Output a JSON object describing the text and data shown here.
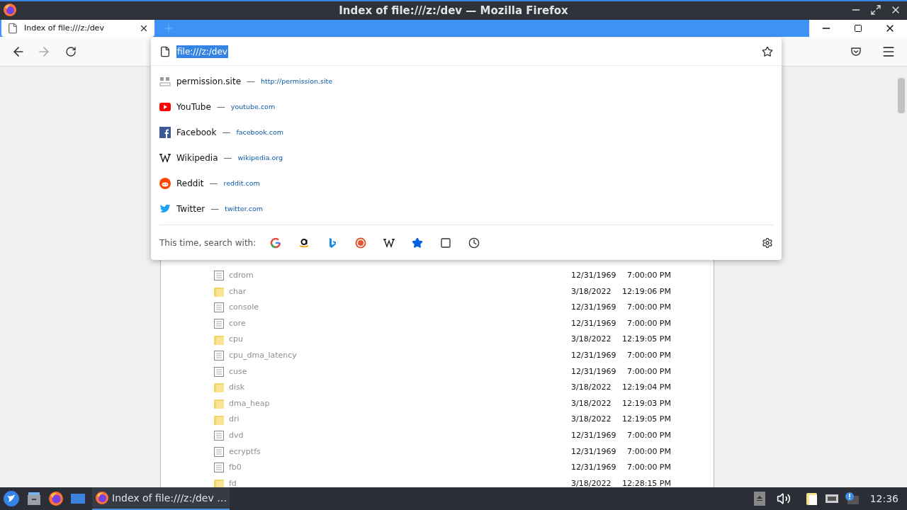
{
  "window": {
    "title": "Index of file:///z:/dev — Mozilla Firefox"
  },
  "tab": {
    "title": "Index of file:///z:/dev",
    "selected": true
  },
  "urlbar": {
    "value": "file:///z:/dev"
  },
  "suggestion_separator": "—",
  "suggestions": [
    {
      "kind": "permission",
      "title": "permission.site",
      "url": "http://permission.site"
    },
    {
      "kind": "youtube",
      "title": "YouTube",
      "url": "youtube.com"
    },
    {
      "kind": "facebook",
      "title": "Facebook",
      "url": "facebook.com"
    },
    {
      "kind": "wikipedia",
      "title": "Wikipedia",
      "url": "wikipedia.org"
    },
    {
      "kind": "reddit",
      "title": "Reddit",
      "url": "reddit.com"
    },
    {
      "kind": "twitter",
      "title": "Twitter",
      "url": "twitter.com"
    }
  ],
  "search_with": {
    "label": "This time, search with:",
    "engines": [
      {
        "kind": "google"
      },
      {
        "kind": "amazon"
      },
      {
        "kind": "bing"
      },
      {
        "kind": "duckduckgo"
      },
      {
        "kind": "wikipedia"
      },
      {
        "kind": "bookmarks"
      },
      {
        "kind": "tabs"
      },
      {
        "kind": "history"
      }
    ]
  },
  "listing": [
    {
      "kind": "file",
      "name": "cdrom",
      "date": "12/31/1969",
      "time": "7:00:00 PM"
    },
    {
      "kind": "folder",
      "name": "char",
      "date": "3/18/2022",
      "time": "12:19:06 PM"
    },
    {
      "kind": "file",
      "name": "console",
      "date": "12/31/1969",
      "time": "7:00:00 PM"
    },
    {
      "kind": "file",
      "name": "core",
      "date": "12/31/1969",
      "time": "7:00:00 PM"
    },
    {
      "kind": "folder",
      "name": "cpu",
      "date": "3/18/2022",
      "time": "12:19:05 PM"
    },
    {
      "kind": "file",
      "name": "cpu_dma_latency",
      "date": "12/31/1969",
      "time": "7:00:00 PM"
    },
    {
      "kind": "file",
      "name": "cuse",
      "date": "12/31/1969",
      "time": "7:00:00 PM"
    },
    {
      "kind": "folder",
      "name": "disk",
      "date": "3/18/2022",
      "time": "12:19:04 PM"
    },
    {
      "kind": "folder",
      "name": "dma_heap",
      "date": "3/18/2022",
      "time": "12:19:03 PM"
    },
    {
      "kind": "folder",
      "name": "dri",
      "date": "3/18/2022",
      "time": "12:19:05 PM"
    },
    {
      "kind": "file",
      "name": "dvd",
      "date": "12/31/1969",
      "time": "7:00:00 PM"
    },
    {
      "kind": "file",
      "name": "ecryptfs",
      "date": "12/31/1969",
      "time": "7:00:00 PM"
    },
    {
      "kind": "file",
      "name": "fb0",
      "date": "12/31/1969",
      "time": "7:00:00 PM"
    },
    {
      "kind": "folder",
      "name": "fd",
      "date": "3/18/2022",
      "time": "12:28:15 PM"
    }
  ],
  "taskbar": {
    "task": {
      "title": "Index of file:///z:/dev …",
      "selected": true
    },
    "clock": "12:36"
  }
}
